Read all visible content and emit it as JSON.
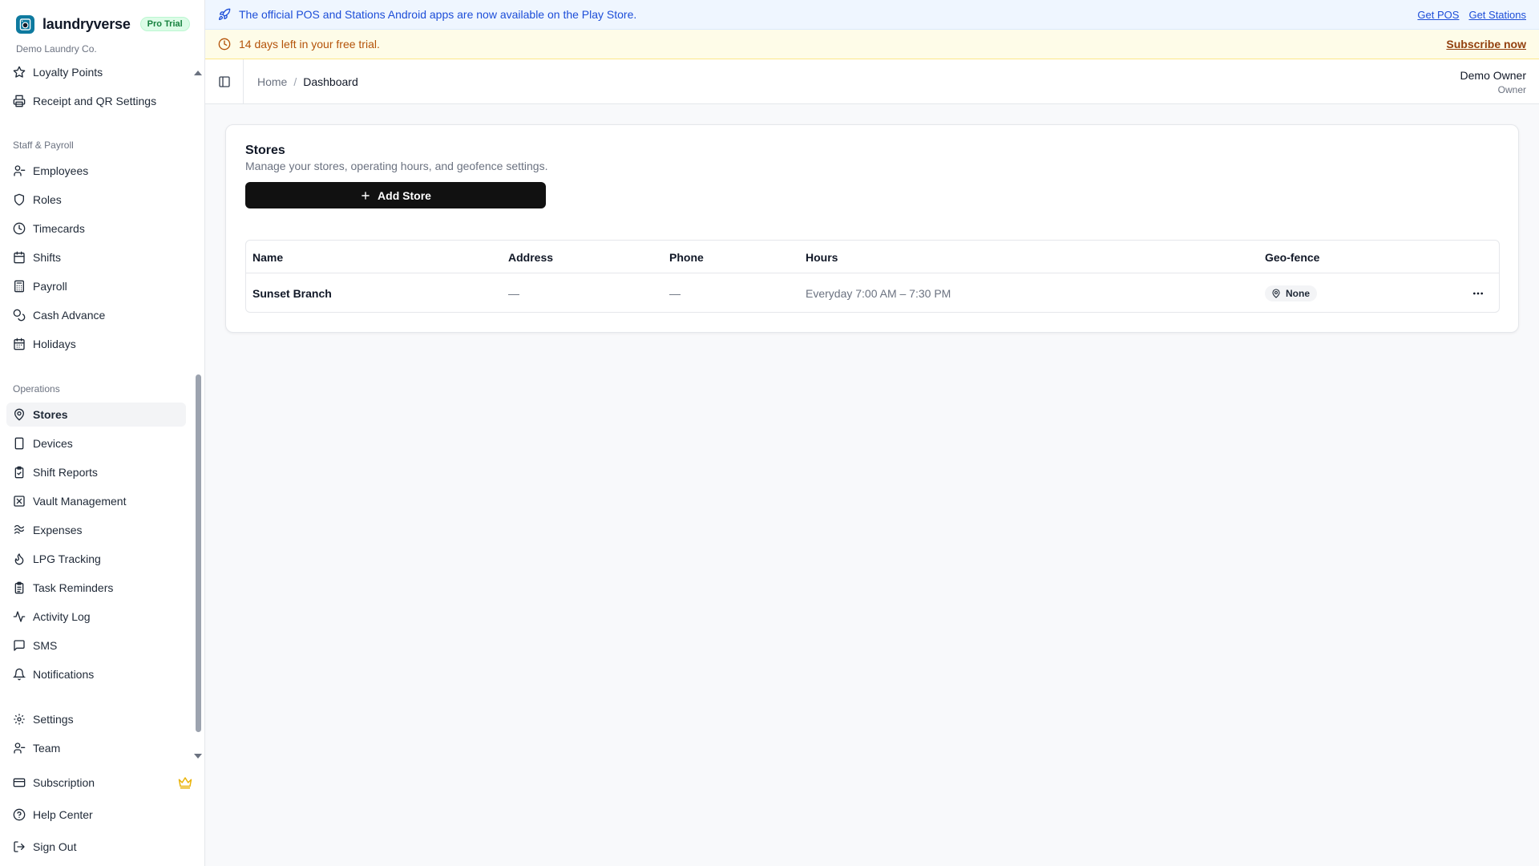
{
  "brand": {
    "name": "laundryverse",
    "badge": "Pro Trial",
    "org": "Demo Laundry Co.",
    "accent": "#0e7a9f"
  },
  "sidebar": {
    "top_items": [
      {
        "label": "Loyalty Points",
        "icon": "star-icon"
      },
      {
        "label": "Receipt and QR Settings",
        "icon": "printer-icon"
      }
    ],
    "sections": [
      {
        "title": "Staff & Payroll",
        "items": [
          {
            "label": "Employees",
            "icon": "users-icon"
          },
          {
            "label": "Roles",
            "icon": "shield-icon"
          },
          {
            "label": "Timecards",
            "icon": "clock-icon"
          },
          {
            "label": "Shifts",
            "icon": "calendar-icon"
          },
          {
            "label": "Payroll",
            "icon": "calculator-icon"
          },
          {
            "label": "Cash Advance",
            "icon": "coins-icon"
          },
          {
            "label": "Holidays",
            "icon": "calendar-days-icon"
          }
        ]
      },
      {
        "title": "Operations",
        "items": [
          {
            "label": "Stores",
            "icon": "map-pin-icon",
            "active": true
          },
          {
            "label": "Devices",
            "icon": "tablet-icon"
          },
          {
            "label": "Shift Reports",
            "icon": "clipboard-check-icon"
          },
          {
            "label": "Vault Management",
            "icon": "vault-icon"
          },
          {
            "label": "Expenses",
            "icon": "receipt-icon"
          },
          {
            "label": "LPG Tracking",
            "icon": "flame-icon"
          },
          {
            "label": "Task Reminders",
            "icon": "clipboard-list-icon"
          },
          {
            "label": "Activity Log",
            "icon": "activity-icon"
          },
          {
            "label": "SMS",
            "icon": "message-square-icon"
          },
          {
            "label": "Notifications",
            "icon": "bell-icon"
          }
        ]
      }
    ],
    "bottom_items": [
      {
        "label": "Settings",
        "icon": "gear-icon"
      },
      {
        "label": "Team",
        "icon": "users-icon"
      },
      {
        "label": "Subscription",
        "icon": "credit-card-icon"
      },
      {
        "label": "Help Center",
        "icon": "help-circle-icon"
      },
      {
        "label": "Sign Out",
        "icon": "log-out-icon"
      }
    ]
  },
  "banners": {
    "info": {
      "message": "The official POS and Stations Android apps are now available on the Play Store.",
      "link_pos": "Get POS",
      "link_stations": "Get Stations",
      "icon": "rocket-icon"
    },
    "trial": {
      "message": "14 days left in your free trial.",
      "link": "Subscribe now",
      "icon": "clock-icon"
    }
  },
  "header": {
    "breadcrumb": {
      "home": "Home",
      "separator": "/",
      "current": "Dashboard"
    },
    "user": {
      "name": "Demo Owner",
      "role": "Owner"
    }
  },
  "stores": {
    "title": "Stores",
    "subtitle": "Manage your stores, operating hours, and geofence settings.",
    "add_button": "Add Store",
    "columns": [
      "Name",
      "Address",
      "Phone",
      "Hours",
      "Geo-fence"
    ],
    "rows": [
      {
        "name": "Sunset Branch",
        "address": "—",
        "phone": "—",
        "hours": "Everyday 7:00 AM – 7:30 PM",
        "geofence": "None"
      }
    ]
  }
}
